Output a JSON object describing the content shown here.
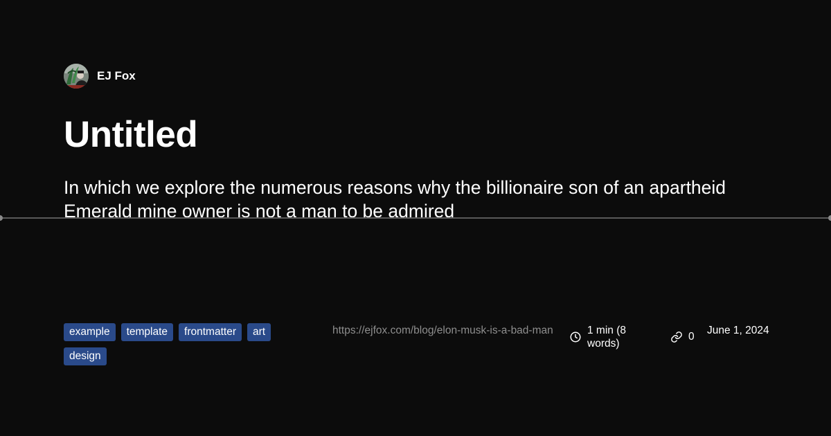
{
  "author": {
    "name": "EJ Fox",
    "avatar_icon": "avatar-image"
  },
  "post": {
    "title": "Untitled",
    "subtitle": "In which we explore the numerous reasons why the billionaire son of an apartheid Emerald mine owner is not a man to be admired",
    "tags": [
      "example",
      "template",
      "frontmatter",
      "art",
      "design"
    ],
    "url": "https://ejfox.com/blog/elon-musk-is-a-bad-man",
    "read_time": "1 min (8 words)",
    "link_count": "0",
    "date": "June 1, 2024"
  },
  "icons": {
    "read_time": "clock-icon",
    "links": "link-icon"
  },
  "colors": {
    "background": "#0c0c0c",
    "text": "#ffffff",
    "muted": "#8e8e8e",
    "tag_background": "#2a4a8a",
    "guide_line": "#5a5a5a"
  }
}
